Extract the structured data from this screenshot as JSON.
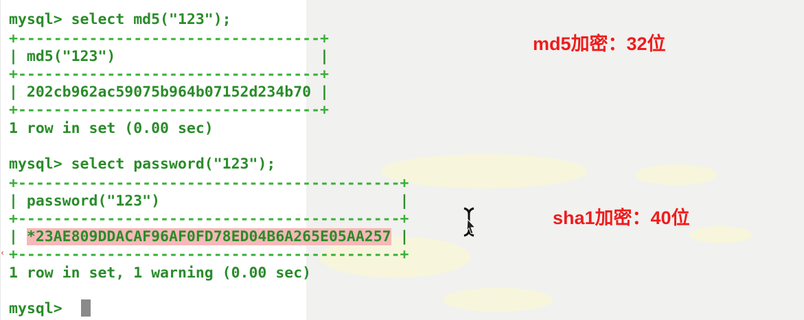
{
  "terminal": {
    "query1": {
      "prompt": "mysql>",
      "command": " select md5(\"123\");",
      "border": "+----------------------------------+",
      "header": "| md5(\"123\")                       |",
      "value_left": "| ",
      "value": "202cb962ac59075b964b07152d234b70",
      "value_right": " |",
      "result": "1 row in set (0.00 sec)"
    },
    "query2": {
      "prompt": "mysql>",
      "command": " select password(\"123\");",
      "border": "+-------------------------------------------+",
      "header": "| password(\"123\")                           |",
      "value_left": "| ",
      "value": "*23AE809DDACAF96AF0FD78ED04B6A265E05AA257",
      "value_right": " |",
      "result": "1 row in set, 1 warning (0.00 sec)"
    },
    "final_prompt": "mysql> "
  },
  "annotations": {
    "md5": "md5加密：32位",
    "sha1": "sha1加密：40位"
  },
  "colors": {
    "terminal_text": "#2a8c2a",
    "annotation": "#ee1c1c",
    "highlight": "#f6b8b8"
  }
}
